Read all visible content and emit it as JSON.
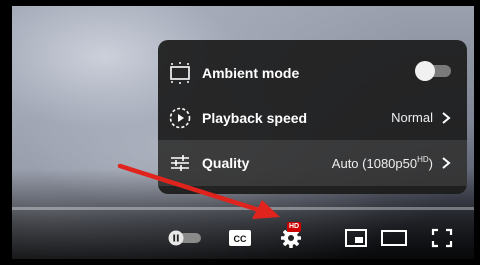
{
  "menu": {
    "items": [
      {
        "label": "Ambient mode",
        "icon": "ambient-mode-icon",
        "toggle_on": false
      },
      {
        "label": "Playback speed",
        "icon": "playback-speed-icon",
        "value": "Normal"
      },
      {
        "label": "Quality",
        "icon": "quality-sliders-icon",
        "value": "Auto (1080p50",
        "value_sup": "HD",
        "value_suffix": ")"
      }
    ]
  },
  "controls": {
    "autoplay_icon": "autoplay-toggle-icon",
    "cc_label": "CC",
    "settings_icon": "gear-icon",
    "settings_badge": "HD",
    "miniplayer_icon": "miniplayer-icon",
    "theater_icon": "theater-mode-icon",
    "fullscreen_icon": "fullscreen-icon"
  },
  "colors": {
    "menu_bg": "#1c1c1c",
    "badge_red": "#cc0000",
    "arrow_red": "#e0231c",
    "text": "#ffffff"
  }
}
